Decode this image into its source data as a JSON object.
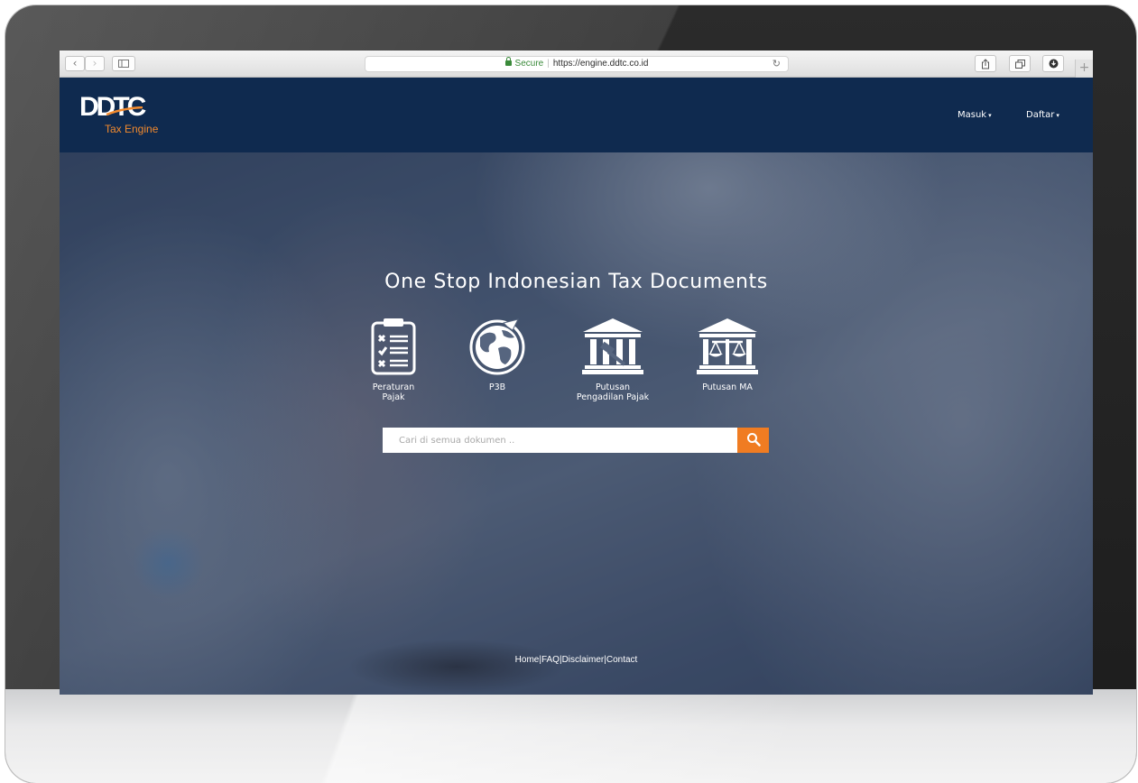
{
  "browser": {
    "back_icon": "chevron-left-icon",
    "forward_icon": "chevron-right-icon",
    "sidebar_icon": "sidebar-icon",
    "secure_label": "Secure",
    "url": "https://engine.ddtc.co.id",
    "reload_icon": "reload-icon",
    "share_icon": "share-icon",
    "tabs_icon": "tabs-icon",
    "download_icon": "download-icon",
    "new_tab_label": "+"
  },
  "header": {
    "logo_text": "DDTC",
    "logo_subtitle": "Tax Engine",
    "nav": [
      {
        "label": "Masuk"
      },
      {
        "label": "Daftar"
      }
    ]
  },
  "hero": {
    "title": "One Stop Indonesian Tax Documents",
    "categories": [
      {
        "label_line1": "Peraturan",
        "label_line2": "Pajak",
        "icon": "clipboard-checklist-icon"
      },
      {
        "label_line1": "P3B",
        "label_line2": "",
        "icon": "globe-icon"
      },
      {
        "label_line1": "Putusan",
        "label_line2": "Pengadilan Pajak",
        "icon": "courthouse-icon"
      },
      {
        "label_line1": "Putusan MA",
        "label_line2": "",
        "icon": "scales-icon"
      }
    ],
    "search": {
      "placeholder": "Cari di semua dokumen ..",
      "value": "",
      "button_icon": "search-icon"
    }
  },
  "footer": {
    "links": [
      "Home",
      "FAQ",
      "Disclaimer",
      "Contact"
    ],
    "separator": "|"
  },
  "colors": {
    "header_bg": "#0f2a4f",
    "accent": "#f07c22",
    "text_light": "#ffffff"
  }
}
